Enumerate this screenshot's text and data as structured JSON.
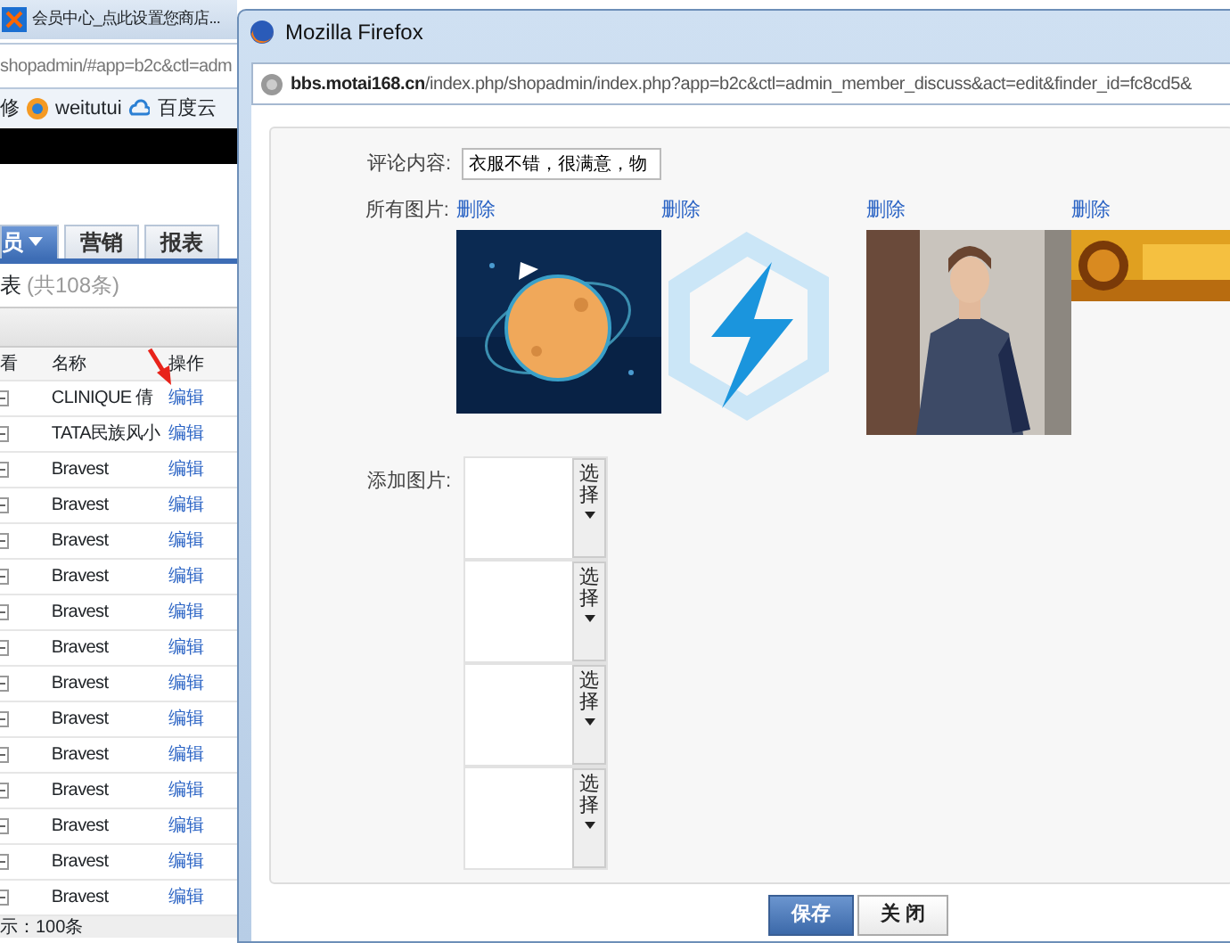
{
  "back_window": {
    "tab_title": "会员中心_点此设置您商店...",
    "address": "shopadmin/#app=b2c&ctl=adm",
    "bookmarks": [
      {
        "label": "修",
        "kind": "text"
      },
      {
        "label": "weitutui",
        "kind": "weitutui"
      },
      {
        "label": "百度云",
        "kind": "cloud"
      }
    ],
    "tabs": [
      {
        "label": "员",
        "selected": true,
        "dropdown": true
      },
      {
        "label": "营销",
        "selected": false,
        "dropdown": false
      },
      {
        "label": "报表",
        "selected": false,
        "dropdown": false
      }
    ],
    "list_title": "表",
    "list_count": "(共108条)",
    "table": {
      "columns": [
        "看",
        "名称",
        "操作"
      ],
      "rows": [
        {
          "name": "CLINIQUE 倩",
          "action": "编辑"
        },
        {
          "name": "TATA民族风小",
          "action": "编辑"
        },
        {
          "name": "Bravest",
          "action": "编辑"
        },
        {
          "name": "Bravest",
          "action": "编辑"
        },
        {
          "name": "Bravest",
          "action": "编辑"
        },
        {
          "name": "Bravest",
          "action": "编辑"
        },
        {
          "name": "Bravest",
          "action": "编辑"
        },
        {
          "name": "Bravest",
          "action": "编辑"
        },
        {
          "name": "Bravest",
          "action": "编辑"
        },
        {
          "name": "Bravest",
          "action": "编辑"
        },
        {
          "name": "Bravest",
          "action": "编辑"
        },
        {
          "name": "Bravest",
          "action": "编辑"
        },
        {
          "name": "Bravest",
          "action": "编辑"
        },
        {
          "name": "Bravest",
          "action": "编辑"
        },
        {
          "name": "Bravest",
          "action": "编辑"
        }
      ]
    },
    "footer": "示：100条"
  },
  "popup": {
    "title": "Mozilla Firefox",
    "url_host": "bbs.motai168.cn",
    "url_path": "/index.php/shopadmin/index.php?app=b2c&ctl=admin_member_discuss&act=edit&finder_id=fc8cd5&",
    "comment_label": "评论内容:",
    "comment_value": "衣服不错，很满意，物",
    "images_label": "所有图片:",
    "images": [
      {
        "delete": "删除",
        "kind": "picture"
      },
      {
        "delete": "删除",
        "kind": "logo"
      },
      {
        "delete": "删除",
        "kind": "picture"
      },
      {
        "delete": "删除",
        "kind": "banner"
      }
    ],
    "add_label": "添加图片:",
    "uploads": [
      {
        "button": "选择"
      },
      {
        "button": "选择"
      },
      {
        "button": "选择"
      },
      {
        "button": "选择"
      }
    ],
    "save": "保存",
    "close": "关 闭"
  }
}
